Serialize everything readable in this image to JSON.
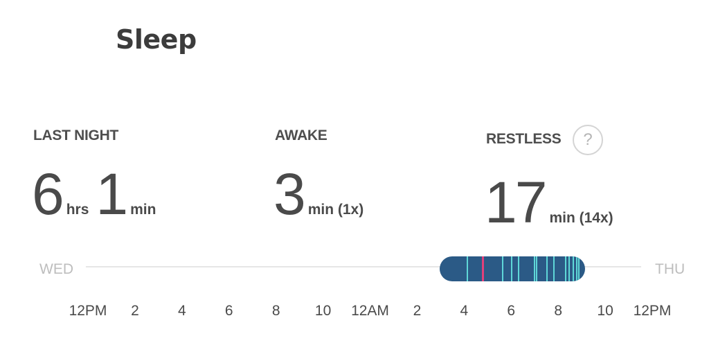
{
  "header": {
    "title": "Sleep",
    "icon": "moon-icon"
  },
  "stats": {
    "last_night": {
      "label": "LAST NIGHT",
      "hours": "6",
      "hours_unit": "hrs",
      "minutes": "1",
      "minutes_unit": "min"
    },
    "awake": {
      "label": "AWAKE",
      "value": "3",
      "unit": "min (1x)"
    },
    "restless": {
      "label": "RESTLESS",
      "value": "17",
      "unit": "min (14x)",
      "help_symbol": "?"
    }
  },
  "timeline": {
    "start_day": "WED",
    "end_day": "THU",
    "ticks": [
      "12PM",
      "2",
      "4",
      "6",
      "8",
      "10",
      "12AM",
      "2",
      "4",
      "6",
      "8",
      "10",
      "12PM"
    ],
    "sleep_period": {
      "start_hour": 14.95,
      "end_hour": 21.15
    },
    "events": [
      {
        "hour": 16.1,
        "type": "restless"
      },
      {
        "hour": 16.75,
        "type": "awake"
      },
      {
        "hour": 17.6,
        "type": "restless"
      },
      {
        "hour": 18.0,
        "type": "restless"
      },
      {
        "hour": 18.3,
        "type": "restless"
      },
      {
        "hour": 18.95,
        "type": "restless"
      },
      {
        "hour": 19.05,
        "type": "restless"
      },
      {
        "hour": 19.5,
        "type": "restless"
      },
      {
        "hour": 19.8,
        "type": "restless"
      },
      {
        "hour": 20.3,
        "type": "restless"
      },
      {
        "hour": 20.45,
        "type": "restless"
      },
      {
        "hour": 20.6,
        "type": "restless"
      },
      {
        "hour": 20.75,
        "type": "restless"
      },
      {
        "hour": 20.85,
        "type": "restless"
      }
    ]
  },
  "colors": {
    "asleep": "#2b5a86",
    "restless": "#5fd8d8",
    "awake": "#e0407a",
    "text": "#4a4a4a",
    "muted": "#bdbdbd"
  }
}
